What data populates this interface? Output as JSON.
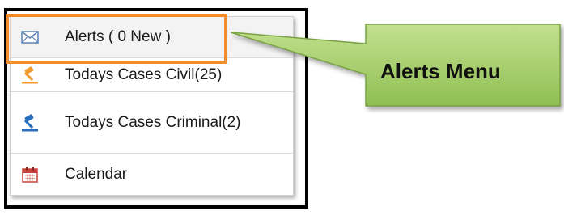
{
  "menu": {
    "items": [
      {
        "label": "Alerts ( 0 New  )",
        "icon": "envelope-icon"
      },
      {
        "label": "Todays Cases Civil(25)",
        "icon": "gavel-icon"
      },
      {
        "label": "Todays Cases Criminal(2)",
        "icon": "gavel-icon"
      },
      {
        "label": "Calendar",
        "icon": "calendar-icon"
      }
    ]
  },
  "callout": {
    "text": "Alerts Menu"
  },
  "colors": {
    "highlight_border": "#f28c28",
    "callout_fill": "#a6d06a",
    "gavel_orange": "#f29a2e",
    "gavel_blue": "#2a6fbf",
    "calendar_red": "#c8423b"
  }
}
